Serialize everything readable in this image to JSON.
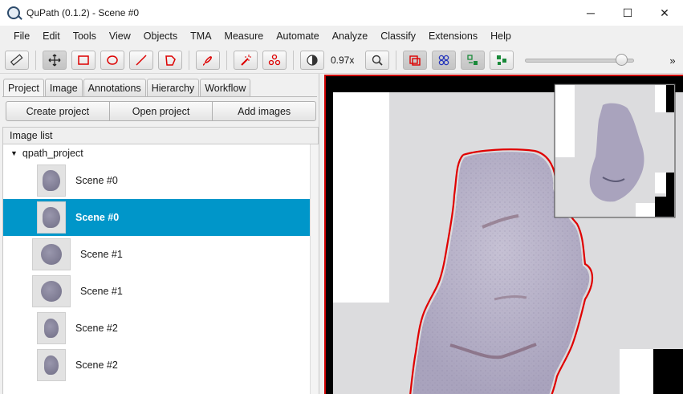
{
  "window": {
    "title": "QuPath (0.1.2) - Scene #0",
    "minimize": "─",
    "maximize": "☐",
    "close": "✕"
  },
  "menu": [
    "File",
    "Edit",
    "Tools",
    "View",
    "Objects",
    "TMA",
    "Measure",
    "Automate",
    "Analyze",
    "Classify",
    "Extensions",
    "Help"
  ],
  "toolbar": {
    "zoom_label": "0.97x",
    "overflow": "»",
    "brightness_slider": {
      "level_fraction": 0.93
    }
  },
  "tabs": [
    "Project",
    "Image",
    "Annotations",
    "Hierarchy",
    "Workflow"
  ],
  "active_tab": "Project",
  "project_actions": {
    "create": "Create project",
    "open": "Open project",
    "add": "Add images"
  },
  "image_list": {
    "header": "Image list",
    "root": "qpath_project",
    "items": [
      {
        "label": "Scene #0",
        "selected": false
      },
      {
        "label": "Scene #0",
        "selected": true
      },
      {
        "label": "Scene #1",
        "selected": false
      },
      {
        "label": "Scene #1",
        "selected": false
      },
      {
        "label": "Scene #2",
        "selected": false
      },
      {
        "label": "Scene #2",
        "selected": false
      }
    ]
  },
  "colors": {
    "selection": "#0096c9",
    "annotation": "#e00000",
    "tissue": "#b8b3c8",
    "background": "#dcdcde"
  }
}
